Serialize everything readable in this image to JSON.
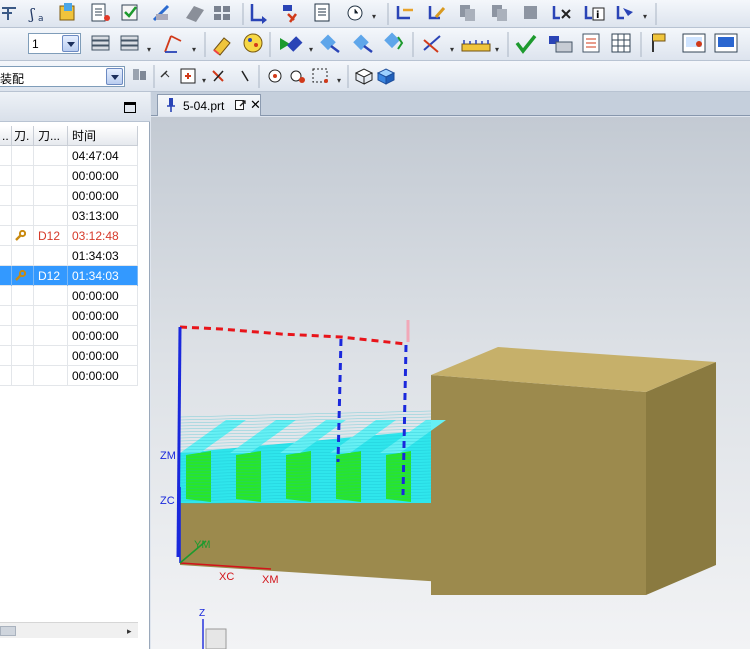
{
  "toolbar": {
    "layer_combo_value": "1",
    "filter_combo_value": "装配"
  },
  "navigator": {
    "columns": [
      "..",
      "刀.",
      "刀...",
      "时间"
    ],
    "rows": [
      {
        "tool": "",
        "time": "04:47:04",
        "warn": false,
        "selected": false,
        "wrench": false
      },
      {
        "tool": "",
        "time": "00:00:00",
        "warn": false,
        "selected": false,
        "wrench": false
      },
      {
        "tool": "",
        "time": "00:00:00",
        "warn": false,
        "selected": false,
        "wrench": false
      },
      {
        "tool": "",
        "time": "03:13:00",
        "warn": false,
        "selected": false,
        "wrench": false
      },
      {
        "tool": "D12",
        "time": "03:12:48",
        "warn": true,
        "selected": false,
        "wrench": true
      },
      {
        "tool": "",
        "time": "01:34:03",
        "warn": false,
        "selected": false,
        "wrench": false
      },
      {
        "tool": "D12",
        "time": "01:34:03",
        "warn": false,
        "selected": true,
        "wrench": true
      },
      {
        "tool": "",
        "time": "00:00:00",
        "warn": false,
        "selected": false,
        "wrench": false
      },
      {
        "tool": "",
        "time": "00:00:00",
        "warn": false,
        "selected": false,
        "wrench": false
      },
      {
        "tool": "",
        "time": "00:00:00",
        "warn": false,
        "selected": false,
        "wrench": false
      },
      {
        "tool": "",
        "time": "00:00:00",
        "warn": false,
        "selected": false,
        "wrench": false
      },
      {
        "tool": "",
        "time": "00:00:00",
        "warn": false,
        "selected": false,
        "wrench": false
      }
    ]
  },
  "document_tab": {
    "label": "5-04.prt"
  },
  "viewport": {
    "axis_labels": {
      "zm": "ZM",
      "zc": "ZC",
      "ym": "YM",
      "xc": "XC",
      "xm": "XM",
      "z": "Z"
    },
    "colors": {
      "block_front": "#9c8a4d",
      "block_top": "#c6b06a",
      "block_side": "#8a7a40",
      "toolpath_cyan": "#2fe6ec",
      "toolpath_green": "#29e62a",
      "rapid_red": "#e8141a",
      "feed_blue": "#1a28dc"
    }
  }
}
